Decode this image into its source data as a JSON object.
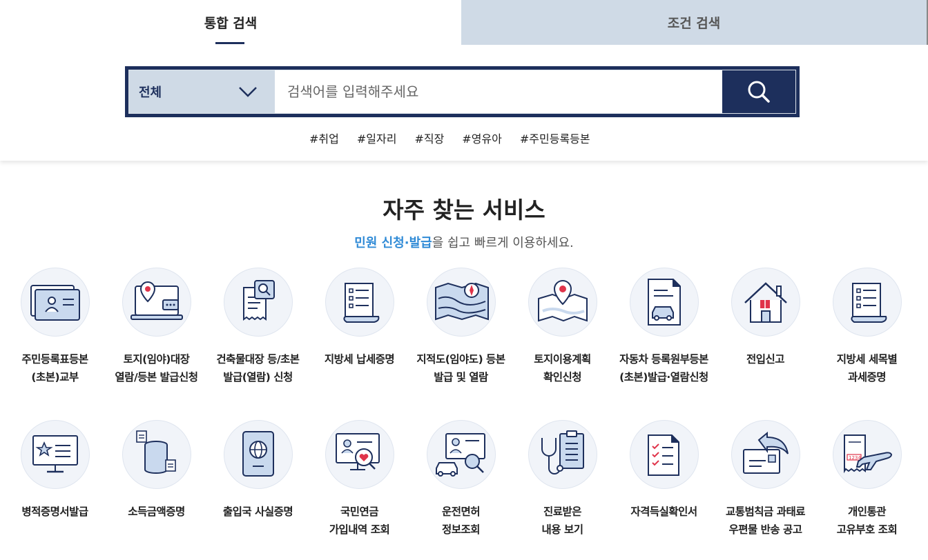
{
  "tabs": [
    {
      "label": "통합 검색",
      "active": true
    },
    {
      "label": "조건 검색",
      "active": false
    }
  ],
  "search": {
    "category": "전체",
    "placeholder": "검색어를 입력해주세요",
    "value": ""
  },
  "tags": [
    "#취업",
    "#일자리",
    "#직장",
    "#영유아",
    "#주민등록등본"
  ],
  "section": {
    "title": "자주 찾는 서비스",
    "subtitle_highlight": "민원 신청·발급",
    "subtitle_rest": "을 쉽고 빠르게 이용하세요."
  },
  "services": [
    {
      "label": "주민등록표등본\n(초본)교부",
      "icon": "resident-card-icon"
    },
    {
      "label": "토지(임야)대장\n열람/등본 발급신청",
      "icon": "laptop-location-icon"
    },
    {
      "label": "건축물대장 등/초본\n발급(열람) 신청",
      "icon": "document-search-icon"
    },
    {
      "label": "지방세 납세증명",
      "icon": "list-scroll-icon"
    },
    {
      "label": "지적도(임야도) 등본\n발급 및 열람",
      "icon": "map-compass-icon"
    },
    {
      "label": "토지이용계획\n확인신청",
      "icon": "map-pin-icon"
    },
    {
      "label": "자동차 등록원부등본\n(초본)발급·열람신청",
      "icon": "car-document-icon"
    },
    {
      "label": "전입신고",
      "icon": "house-icon"
    },
    {
      "label": "지방세 세목별\n과세증명",
      "icon": "list-scroll-icon"
    },
    {
      "label": "병적증명서발급",
      "icon": "star-monitor-icon"
    },
    {
      "label": "소득금액증명",
      "icon": "coin-stack-icon"
    },
    {
      "label": "출입국 사실증명",
      "icon": "passport-icon"
    },
    {
      "label": "국민연금\n가입내역 조회",
      "icon": "heart-search-icon"
    },
    {
      "label": "운전면허\n정보조회",
      "icon": "license-car-icon"
    },
    {
      "label": "진료받은\n내용 보기",
      "icon": "stethoscope-icon"
    },
    {
      "label": "자격득실확인서",
      "icon": "checklist-icon"
    },
    {
      "label": "교통범칙금 과태료\n우편물 반송 공고",
      "icon": "return-mail-icon"
    },
    {
      "label": "개인통관\n고유부호 조회",
      "icon": "airplane-receipt-icon"
    }
  ],
  "colors": {
    "navy": "#1d2f5c",
    "tab_inactive_bg": "#cfdae6",
    "highlight_blue": "#2f8ad6",
    "icon_accent_red": "#e0344a"
  }
}
